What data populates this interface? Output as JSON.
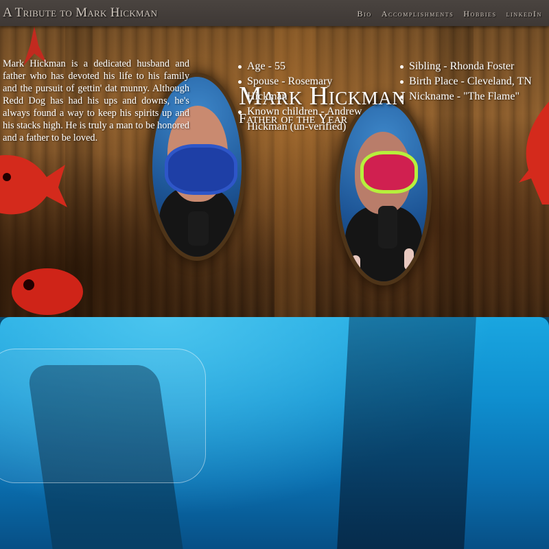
{
  "navbar": {
    "brand": "A Tribute to Mark Hickman",
    "links": [
      "Bio",
      "Accomplishments",
      "Hobbies",
      "linkedIn"
    ]
  },
  "hero": {
    "title": "Mark Hickman",
    "subtitle": "Father of the Year"
  },
  "bio": {
    "text": "Mark Hickman is a dedicated husband and father who has devoted his life to his family and the pursuit of gettin' dat munny. Although Redd Dog has had his ups and downs, he's always found a way to keep his spirits up and his stacks high. He is truly a man to be honored and a father to be loved."
  },
  "facts_left": [
    "Age - 55",
    "Spouse - Rosemary Hickman",
    "Known children - Andrew Hickman (un-verified)"
  ],
  "facts_right": [
    "Sibling - Rhonda Foster",
    "Birth Place - Cleveland, TN",
    "Nickname - \"The Flame\""
  ]
}
